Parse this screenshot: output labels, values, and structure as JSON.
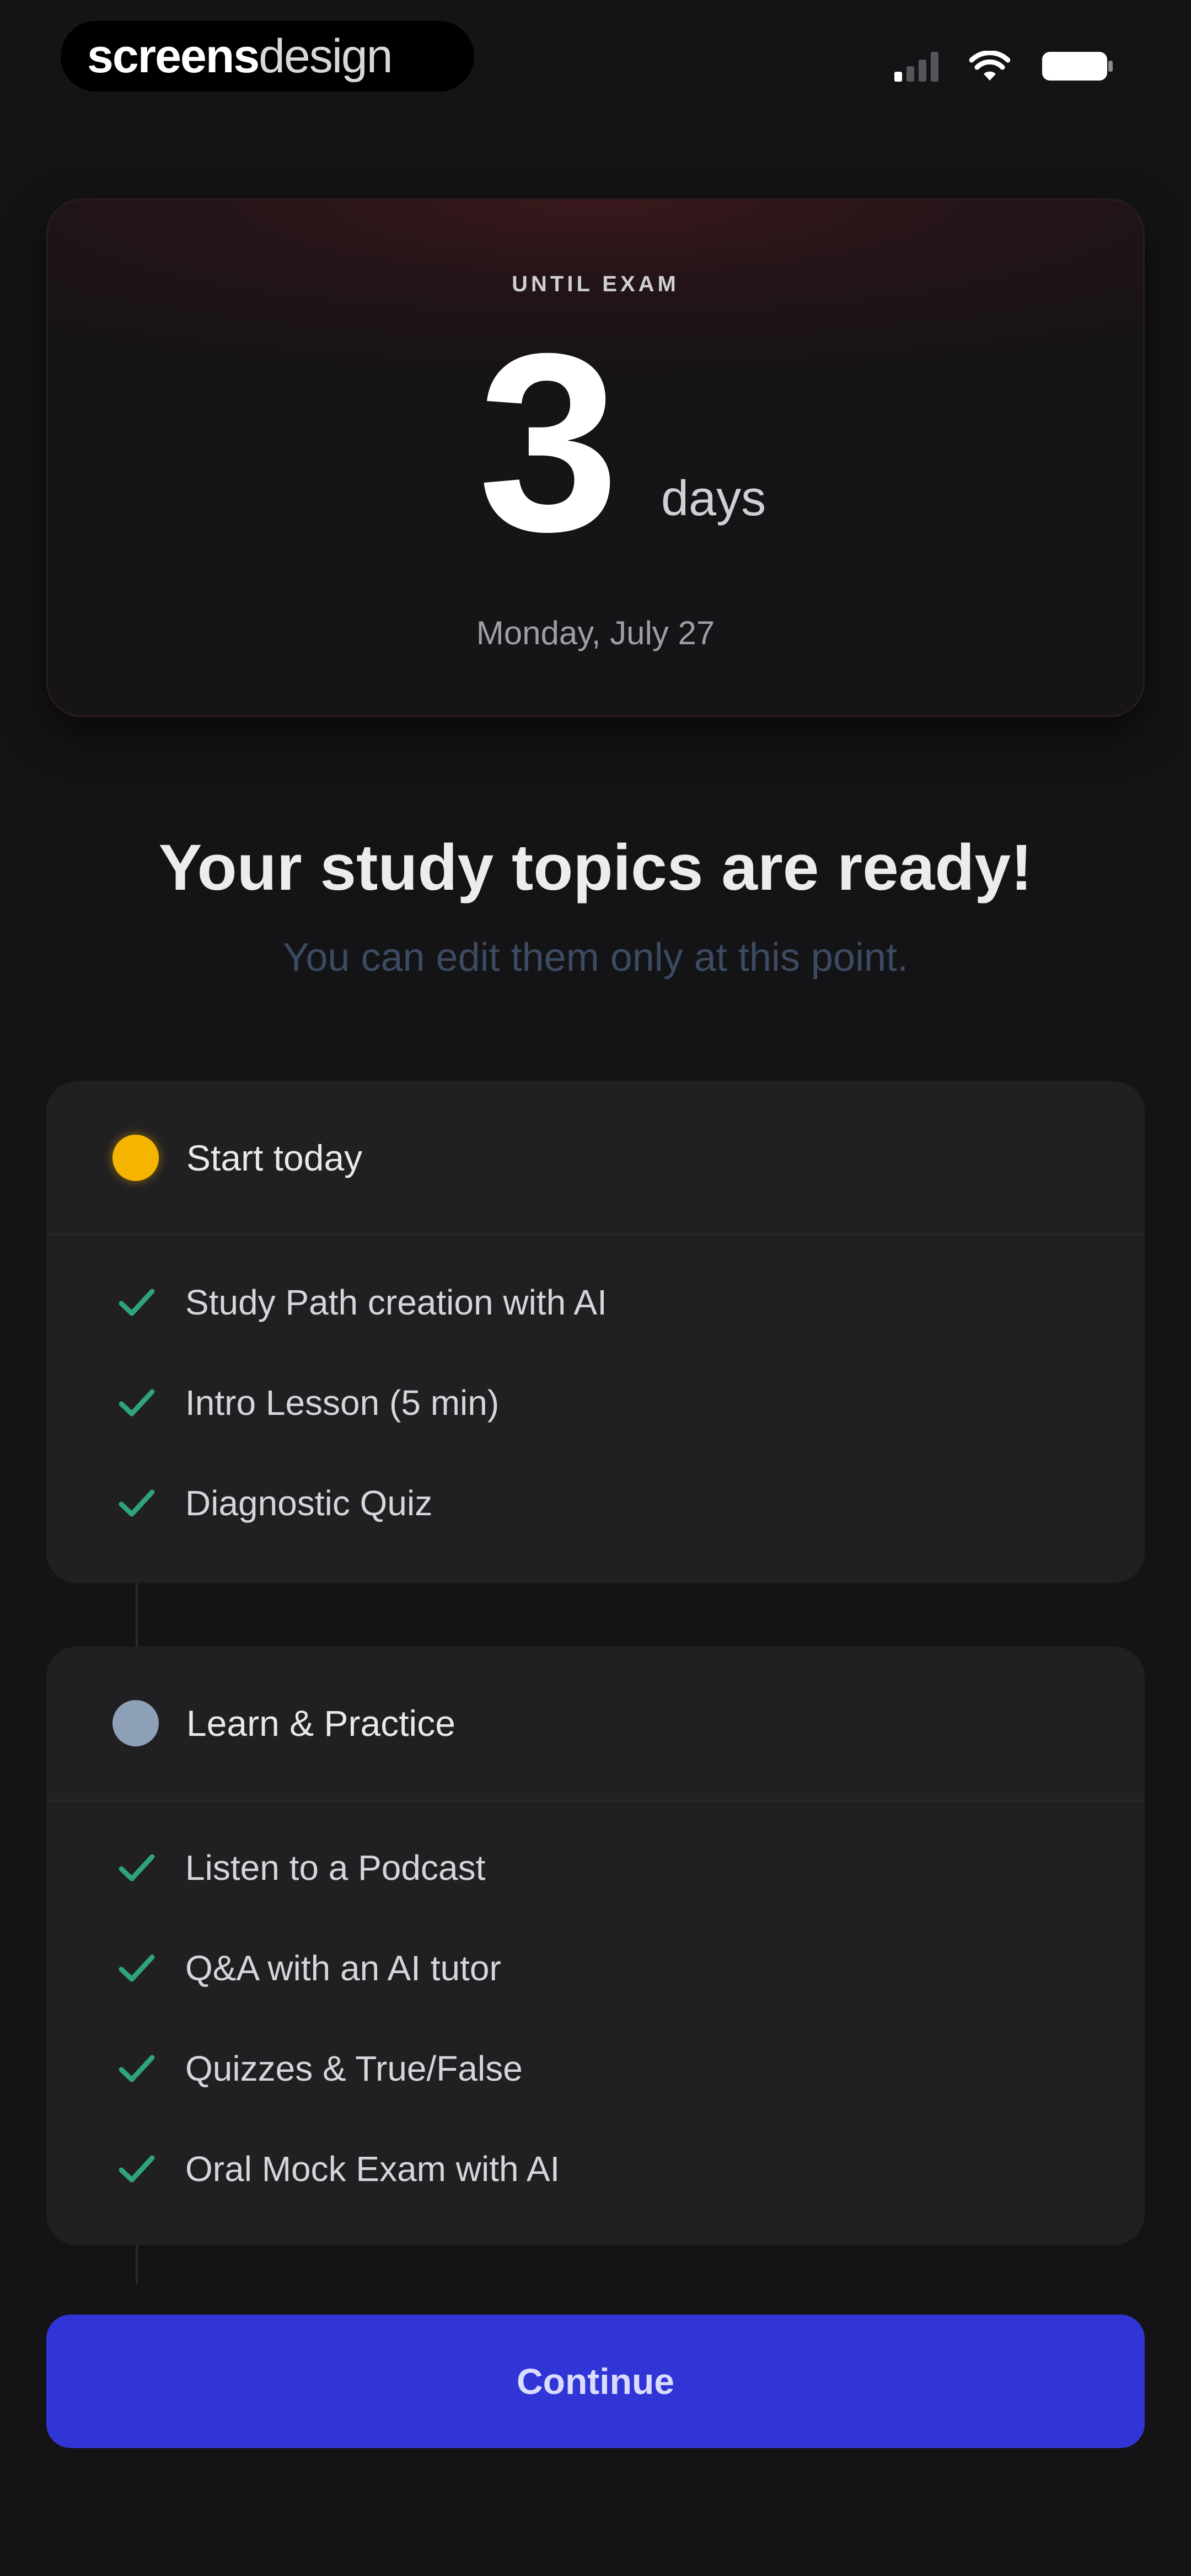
{
  "status_bar": {
    "brand_bold": "screens",
    "brand_light": "design"
  },
  "countdown": {
    "label": "UNTIL EXAM",
    "number": "3",
    "unit": "days",
    "date": "Monday, July 27"
  },
  "heading": {
    "title": "Your study topics are ready!",
    "subtitle": "You can edit them only at this point."
  },
  "sections": [
    {
      "title": "Start today",
      "dot_color": "#f5b400",
      "tasks": [
        "Study Path creation with AI",
        "Intro Lesson (5 min)",
        "Diagnostic Quiz"
      ]
    },
    {
      "title": "Learn & Practice",
      "dot_color": "#8ea0b8",
      "tasks": [
        "Listen to a Podcast",
        "Q&A with an AI tutor",
        "Quizzes & True/False",
        "Oral Mock Exam with AI"
      ]
    }
  ],
  "actions": {
    "continue_label": "Continue"
  },
  "colors": {
    "accent": "#3135d6",
    "check": "#2fa37a",
    "background": "#141416"
  },
  "icons": {
    "signal": "cellular-signal-icon",
    "wifi": "wifi-icon",
    "battery": "battery-icon",
    "check": "checkmark-icon"
  }
}
